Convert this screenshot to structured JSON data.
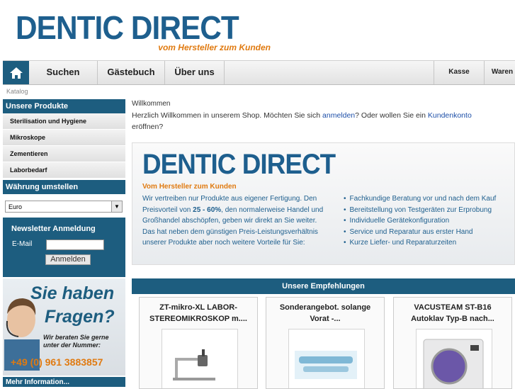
{
  "logo": {
    "text": "DENTIC DIRECT",
    "slogan": "vom Hersteller zum Kunden"
  },
  "nav": {
    "home_icon": "home-icon",
    "items": [
      "Suchen",
      "Gästebuch",
      "Über uns"
    ],
    "right_items": [
      "Kasse",
      "Waren"
    ]
  },
  "breadcrumb": "Katalog",
  "sidebar": {
    "products_heading": "Unsere Produkte",
    "products": [
      "Sterilisation und Hygiene",
      "Mikroskope",
      "Zementieren",
      "Laborbedarf"
    ],
    "currency_heading": "Währung umstellen",
    "currency_value": "Euro",
    "newsletter": {
      "title": "Newsletter Anmeldung",
      "email_label": "E-Mail",
      "button": "Anmelden"
    },
    "promo": {
      "line1": "Sie haben",
      "line2": "Fragen?",
      "sub1": "Wir beraten Sie gerne",
      "sub2": "unter der Nummer:",
      "phone": "+49 (0) 961 3883857"
    },
    "more": "Mehr Information..."
  },
  "main": {
    "welcome_title": "Willkommen",
    "welcome_pre": "Herzlich Willkommen in unserem Shop. Möchten Sie sich ",
    "welcome_link1": "anmelden",
    "welcome_mid": "? Oder wollen Sie ein ",
    "welcome_link2": "Kundenkonto",
    "welcome_post": "eröffnen?",
    "banner": {
      "logo": "DENTIC DIRECT",
      "slogan": "Vom Hersteller zum Kunden",
      "desc_1": "Wir vertreiben nur Produkte aus eigener Fertigung. Den Preisvorteil von ",
      "desc_bold": "25 - 60%",
      "desc_2": ", den normalerweise Handel und Großhandel abschöpfen, geben wir direkt an Sie weiter. Das hat neben dem günstigen Preis-Leistungsverhältnis unserer Produkte aber noch weitere Vorteile für Sie:",
      "bullets": [
        "Fachkundige Beratung vor und nach dem Kauf",
        "Bereitstellung von Testgeräten zur Erprobung",
        "Individuelle Gerätekonfiguration",
        "Service und Reparatur aus erster Hand",
        "Kurze Liefer- und Reparaturzeiten"
      ]
    },
    "recommendations_heading": "Unsere Empfehlungen",
    "cards": [
      {
        "title": "ZT-mikro-XL LABOR-STEREOMIKROSKOP m...."
      },
      {
        "title": "Sonderangebot. solange Vorat -..."
      },
      {
        "title": "VACUSTEAM ST-B16 Autoklav Typ-B nach..."
      }
    ]
  },
  "colors": {
    "brand_blue": "#1d5d7f",
    "logo_blue": "#1e5f8e",
    "accent_orange": "#e07a10",
    "link_blue": "#1d4fa8"
  }
}
